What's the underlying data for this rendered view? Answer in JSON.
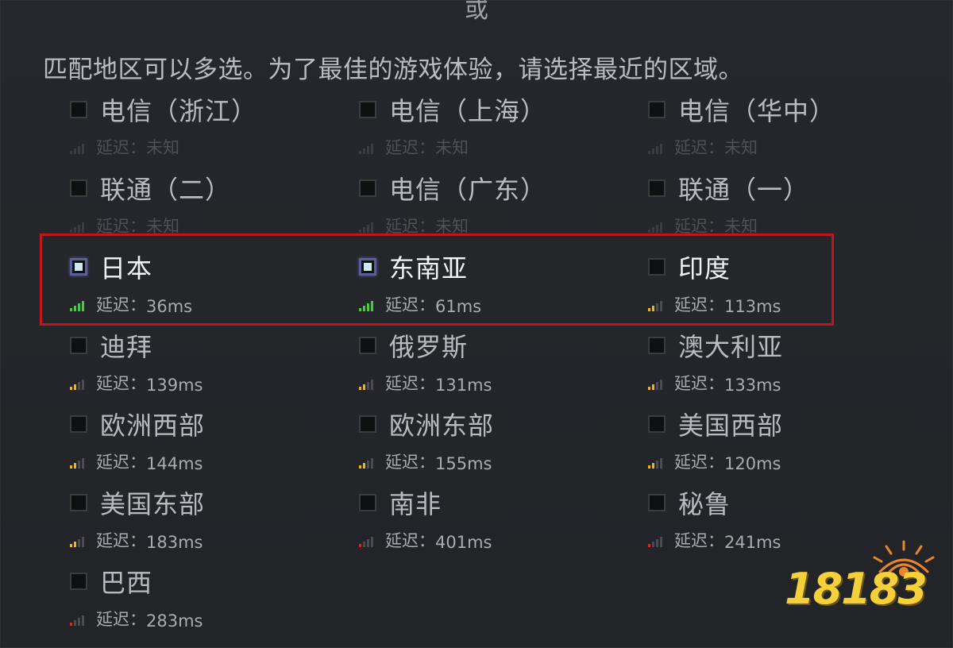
{
  "separator": "或",
  "instruction": "匹配地区可以多选。为了最佳的游戏体验，请选择最近的区域。",
  "latency_prefix": "延迟：",
  "colors": {
    "green": "#3fcf3a",
    "yellow": "#f0b51d",
    "red": "#d8262b",
    "unknown": "#3a3c41",
    "highlight": "#c0161c"
  },
  "regions": [
    {
      "name": "电信（浙江）",
      "latency": "未知",
      "signal": "unknown",
      "bars": 0,
      "checked": false
    },
    {
      "name": "电信（上海）",
      "latency": "未知",
      "signal": "unknown",
      "bars": 0,
      "checked": false
    },
    {
      "name": "电信（华中）",
      "latency": "未知",
      "signal": "unknown",
      "bars": 0,
      "checked": false
    },
    {
      "name": "联通（二）",
      "latency": "未知",
      "signal": "unknown",
      "bars": 0,
      "checked": false
    },
    {
      "name": "电信（广东）",
      "latency": "未知",
      "signal": "unknown",
      "bars": 0,
      "checked": false
    },
    {
      "name": "联通（一）",
      "latency": "未知",
      "signal": "unknown",
      "bars": 0,
      "checked": false
    },
    {
      "name": "日本",
      "latency": "36ms",
      "signal": "green",
      "bars": 4,
      "checked": true
    },
    {
      "name": "东南亚",
      "latency": "61ms",
      "signal": "green",
      "bars": 4,
      "checked": true
    },
    {
      "name": "印度",
      "latency": "113ms",
      "signal": "yellow",
      "bars": 2,
      "checked": false
    },
    {
      "name": "迪拜",
      "latency": "139ms",
      "signal": "yellow",
      "bars": 2,
      "checked": false
    },
    {
      "name": "俄罗斯",
      "latency": "131ms",
      "signal": "yellow",
      "bars": 2,
      "checked": false
    },
    {
      "name": "澳大利亚",
      "latency": "133ms",
      "signal": "yellow",
      "bars": 2,
      "checked": false
    },
    {
      "name": "欧洲西部",
      "latency": "144ms",
      "signal": "yellow",
      "bars": 2,
      "checked": false
    },
    {
      "name": "欧洲东部",
      "latency": "155ms",
      "signal": "yellow",
      "bars": 2,
      "checked": false
    },
    {
      "name": "美国西部",
      "latency": "120ms",
      "signal": "yellow",
      "bars": 2,
      "checked": false
    },
    {
      "name": "美国东部",
      "latency": "183ms",
      "signal": "yellow",
      "bars": 2,
      "checked": false
    },
    {
      "name": "南非",
      "latency": "401ms",
      "signal": "red",
      "bars": 1,
      "checked": false
    },
    {
      "name": "秘鲁",
      "latency": "241ms",
      "signal": "red",
      "bars": 1,
      "checked": false
    },
    {
      "name": "巴西",
      "latency": "283ms",
      "signal": "red",
      "bars": 1,
      "checked": false
    }
  ],
  "watermark": {
    "text": "18183"
  }
}
